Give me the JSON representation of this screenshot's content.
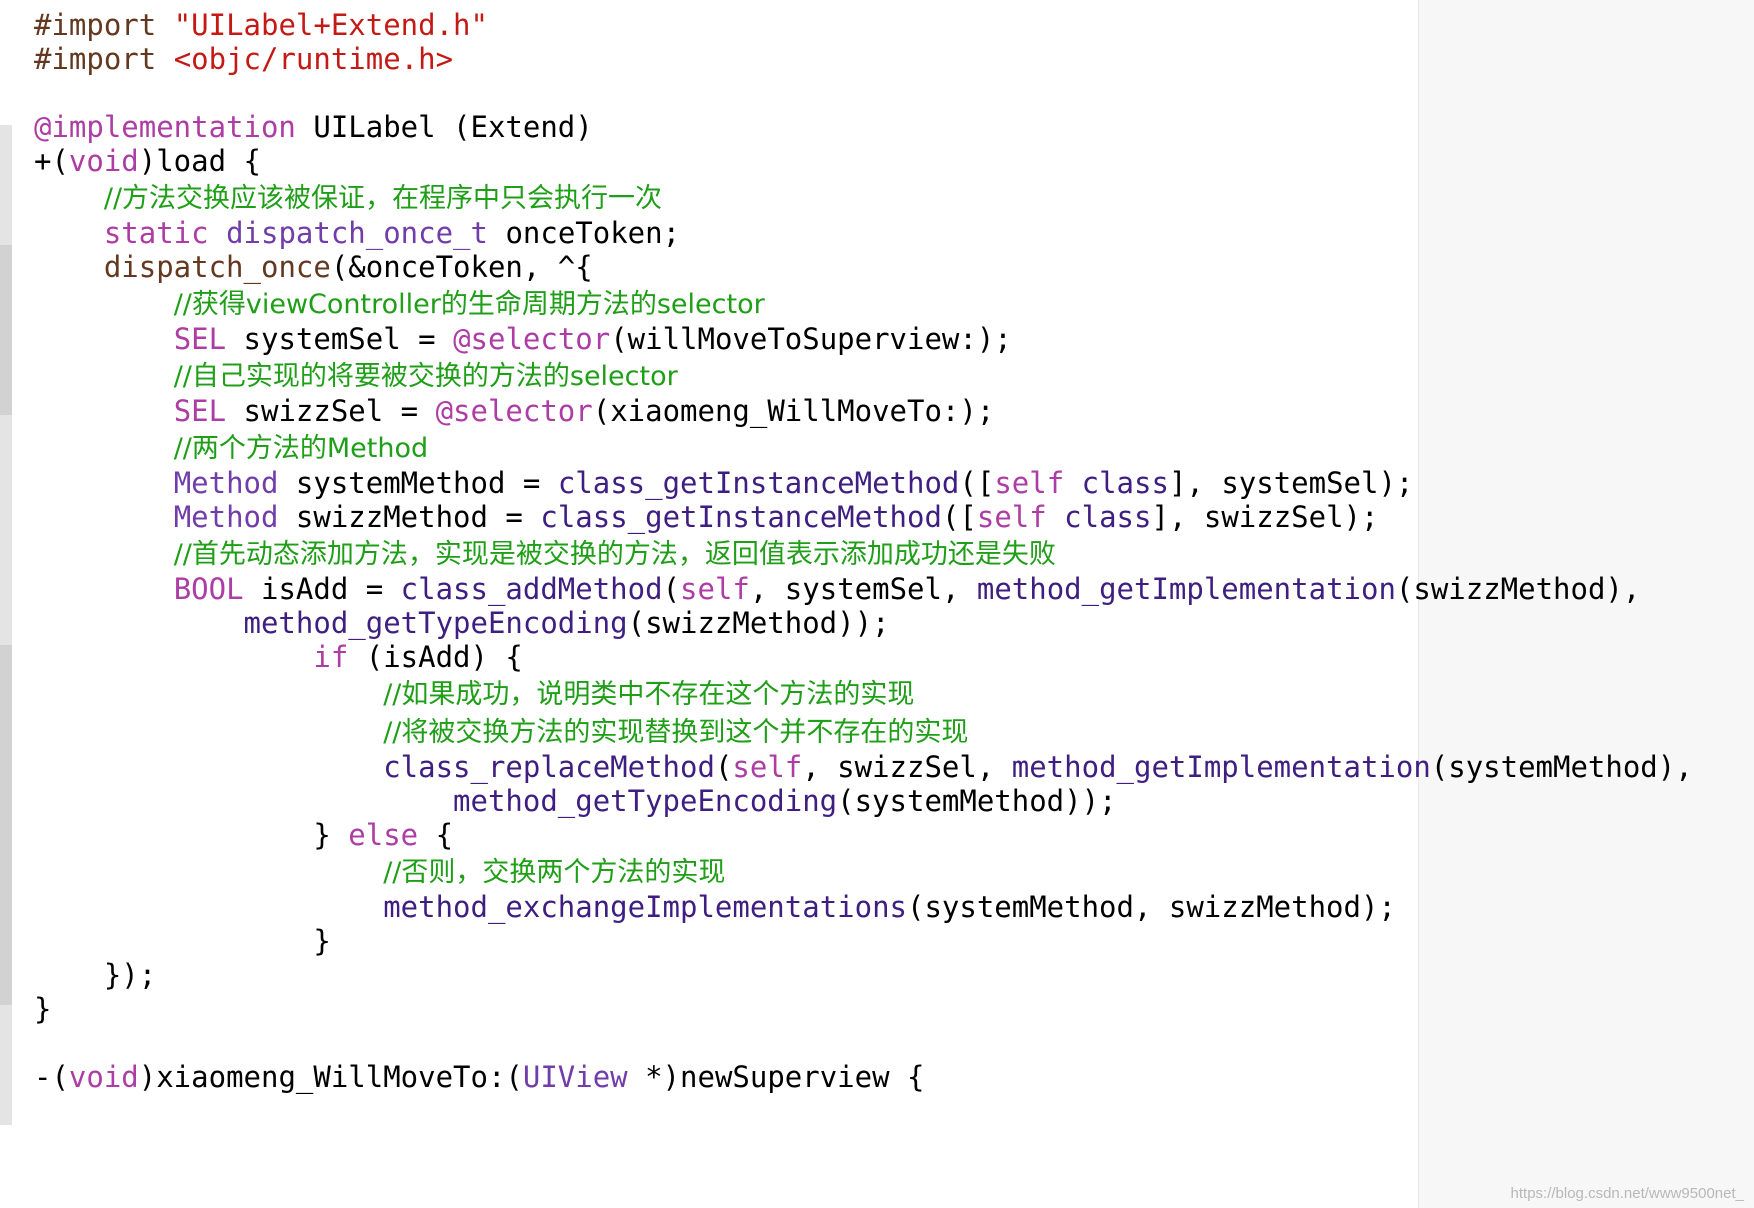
{
  "code_lines": [
    [
      {
        "t": "#import ",
        "c": "pp"
      },
      {
        "t": "\"UILabel+Extend.h\"",
        "c": "str"
      }
    ],
    [
      {
        "t": "#import ",
        "c": "pp"
      },
      {
        "t": "<objc/runtime.h>",
        "c": "str"
      }
    ],
    [],
    [
      {
        "t": "@implementation",
        "c": "kw"
      },
      {
        "t": " UILabel (Extend)",
        "c": ""
      }
    ],
    [
      {
        "t": "+(",
        "c": ""
      },
      {
        "t": "void",
        "c": "kw"
      },
      {
        "t": ")load {",
        "c": ""
      }
    ],
    [
      {
        "t": "    ",
        "c": ""
      },
      {
        "t": "//方法交换应该被保证，在程序中只会执行一次",
        "c": "cm"
      }
    ],
    [
      {
        "t": "    ",
        "c": ""
      },
      {
        "t": "static",
        "c": "kw"
      },
      {
        "t": " ",
        "c": ""
      },
      {
        "t": "dispatch_once_t",
        "c": "typ"
      },
      {
        "t": " onceToken;",
        "c": ""
      }
    ],
    [
      {
        "t": "    ",
        "c": ""
      },
      {
        "t": "dispatch_once",
        "c": "mac"
      },
      {
        "t": "(&onceToken, ^{",
        "c": ""
      }
    ],
    [
      {
        "t": "        ",
        "c": ""
      },
      {
        "t": "//获得viewController的生命周期方法的selector",
        "c": "cm"
      }
    ],
    [
      {
        "t": "        ",
        "c": ""
      },
      {
        "t": "SEL",
        "c": "kw"
      },
      {
        "t": " systemSel = ",
        "c": ""
      },
      {
        "t": "@selector",
        "c": "kw"
      },
      {
        "t": "(willMoveToSuperview:);",
        "c": ""
      }
    ],
    [
      {
        "t": "        ",
        "c": ""
      },
      {
        "t": "//自己实现的将要被交换的方法的selector",
        "c": "cm"
      }
    ],
    [
      {
        "t": "        ",
        "c": ""
      },
      {
        "t": "SEL",
        "c": "kw"
      },
      {
        "t": " swizzSel = ",
        "c": ""
      },
      {
        "t": "@selector",
        "c": "kw"
      },
      {
        "t": "(xiaomeng_WillMoveTo:);",
        "c": ""
      }
    ],
    [
      {
        "t": "        ",
        "c": ""
      },
      {
        "t": "//两个方法的Method",
        "c": "cm"
      }
    ],
    [
      {
        "t": "        ",
        "c": ""
      },
      {
        "t": "Method",
        "c": "typ"
      },
      {
        "t": " systemMethod = ",
        "c": ""
      },
      {
        "t": "class_getInstanceMethod",
        "c": "fn"
      },
      {
        "t": "([",
        "c": ""
      },
      {
        "t": "self",
        "c": "kw"
      },
      {
        "t": " ",
        "c": ""
      },
      {
        "t": "class",
        "c": "fn"
      },
      {
        "t": "], systemSel);",
        "c": ""
      }
    ],
    [
      {
        "t": "        ",
        "c": ""
      },
      {
        "t": "Method",
        "c": "typ"
      },
      {
        "t": " swizzMethod = ",
        "c": ""
      },
      {
        "t": "class_getInstanceMethod",
        "c": "fn"
      },
      {
        "t": "([",
        "c": ""
      },
      {
        "t": "self",
        "c": "kw"
      },
      {
        "t": " ",
        "c": ""
      },
      {
        "t": "class",
        "c": "fn"
      },
      {
        "t": "], swizzSel);",
        "c": ""
      }
    ],
    [
      {
        "t": "        ",
        "c": ""
      },
      {
        "t": "//首先动态添加方法，实现是被交换的方法，返回值表示添加成功还是失败",
        "c": "cm"
      }
    ],
    [
      {
        "t": "        ",
        "c": ""
      },
      {
        "t": "BOOL",
        "c": "kw"
      },
      {
        "t": " isAdd = ",
        "c": ""
      },
      {
        "t": "class_addMethod",
        "c": "fn"
      },
      {
        "t": "(",
        "c": ""
      },
      {
        "t": "self",
        "c": "kw"
      },
      {
        "t": ", systemSel, ",
        "c": ""
      },
      {
        "t": "method_getImplementation",
        "c": "fn"
      },
      {
        "t": "(swizzMethod),",
        "c": ""
      }
    ],
    [
      {
        "t": "            ",
        "c": ""
      },
      {
        "t": "method_getTypeEncoding",
        "c": "fn"
      },
      {
        "t": "(swizzMethod));",
        "c": ""
      }
    ],
    [
      {
        "t": "                ",
        "c": ""
      },
      {
        "t": "if",
        "c": "kw"
      },
      {
        "t": " (isAdd) {",
        "c": ""
      }
    ],
    [
      {
        "t": "                    ",
        "c": ""
      },
      {
        "t": "//如果成功，说明类中不存在这个方法的实现",
        "c": "cm"
      }
    ],
    [
      {
        "t": "                    ",
        "c": ""
      },
      {
        "t": "//将被交换方法的实现替换到这个并不存在的实现",
        "c": "cm"
      }
    ],
    [
      {
        "t": "                    ",
        "c": ""
      },
      {
        "t": "class_replaceMethod",
        "c": "fn"
      },
      {
        "t": "(",
        "c": ""
      },
      {
        "t": "self",
        "c": "kw"
      },
      {
        "t": ", swizzSel, ",
        "c": ""
      },
      {
        "t": "method_getImplementation",
        "c": "fn"
      },
      {
        "t": "(systemMethod),",
        "c": ""
      }
    ],
    [
      {
        "t": "                        ",
        "c": ""
      },
      {
        "t": "method_getTypeEncoding",
        "c": "fn"
      },
      {
        "t": "(systemMethod));",
        "c": ""
      }
    ],
    [
      {
        "t": "                } ",
        "c": ""
      },
      {
        "t": "else",
        "c": "kw"
      },
      {
        "t": " {",
        "c": ""
      }
    ],
    [
      {
        "t": "                    ",
        "c": ""
      },
      {
        "t": "//否则，交换两个方法的实现",
        "c": "cm"
      }
    ],
    [
      {
        "t": "                    ",
        "c": ""
      },
      {
        "t": "method_exchangeImplementations",
        "c": "fn"
      },
      {
        "t": "(systemMethod, swizzMethod);",
        "c": ""
      }
    ],
    [
      {
        "t": "                }",
        "c": ""
      }
    ],
    [
      {
        "t": "    });",
        "c": ""
      }
    ],
    [
      {
        "t": "}",
        "c": ""
      }
    ],
    [],
    [
      {
        "t": "-(",
        "c": ""
      },
      {
        "t": "void",
        "c": "kw"
      },
      {
        "t": ")xiaomeng_WillMoveTo:(",
        "c": ""
      },
      {
        "t": "UIView",
        "c": "typ"
      },
      {
        "t": " *)newSuperview {",
        "c": ""
      }
    ]
  ],
  "watermark": "https://blog.csdn.net/www9500net_",
  "colors": {
    "keyword": "#ad3da4",
    "string": "#c41a16",
    "comment": "#1f9e17",
    "type": "#703daa",
    "function": "#3e1e81",
    "preprocessor": "#643820"
  }
}
